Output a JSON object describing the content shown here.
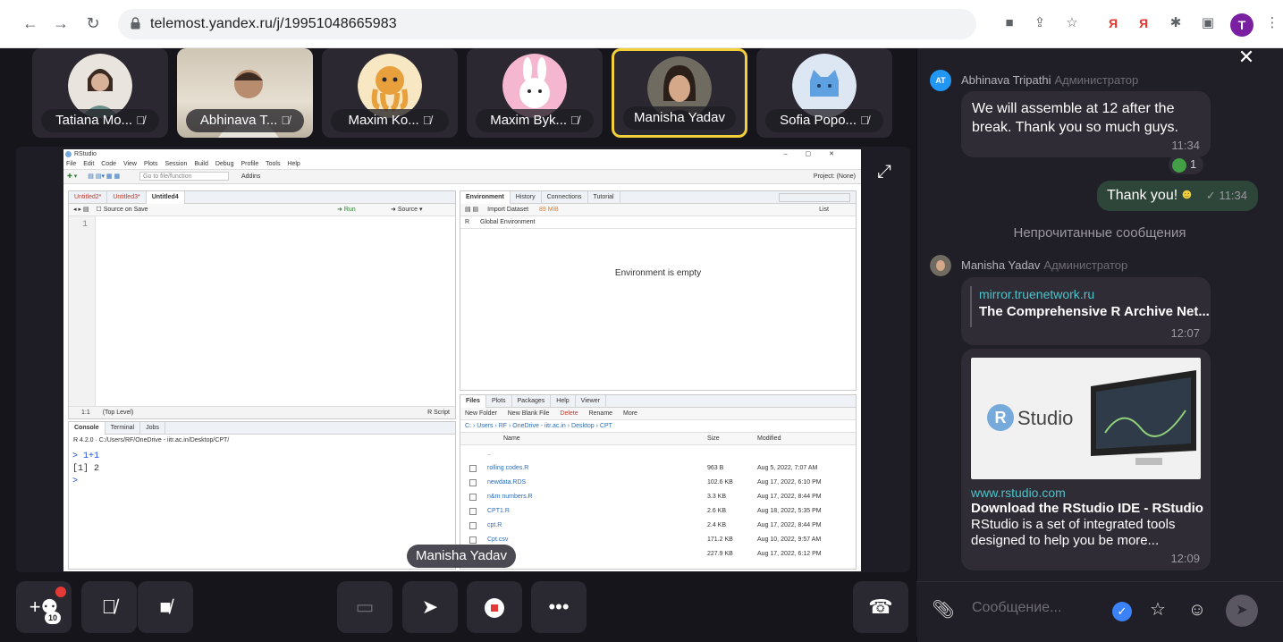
{
  "browser": {
    "url": "telemost.yandex.ru/j/19951048665983",
    "profile_initial": "T",
    "ext_ya": "Я"
  },
  "participants": [
    {
      "name": "Tatiana Mo..."
    },
    {
      "name": "Abhinava T..."
    },
    {
      "name": "Maxim Ko..."
    },
    {
      "name": "Maxim Byk..."
    },
    {
      "name": "Manisha Yadav"
    },
    {
      "name": "Sofia Popo..."
    }
  ],
  "rstudio": {
    "title": "RStudio",
    "menu": [
      "File",
      "Edit",
      "Code",
      "View",
      "Plots",
      "Session",
      "Build",
      "Debug",
      "Profile",
      "Tools",
      "Help"
    ],
    "goto_placeholder": "Go to file/function",
    "addins": "Addins",
    "project": "Project: (None)",
    "editor_tabs": [
      "Untitled2*",
      "Untitled3*",
      "Untitled4"
    ],
    "source_on_save": "Source on Save",
    "run": "Run",
    "source": "Source",
    "line_no": "1",
    "status_pos": "1:1",
    "status_level": "(Top Level)",
    "status_type": "R Script",
    "console_tabs": [
      "Console",
      "Terminal",
      "Jobs"
    ],
    "console_path": "R 4.2.0 · C:/Users/RF/OneDrive - iitr.ac.in/Desktop/CPT/",
    "console_lines": [
      "> 1+1",
      "[1] 2",
      ">"
    ],
    "env_tabs": [
      "Environment",
      "History",
      "Connections",
      "Tutorial"
    ],
    "env_toolbar": "Import Dataset",
    "env_mem": "89 MiB",
    "env_list": "List",
    "env_r": "R",
    "env_global": "Global Environment",
    "env_empty": "Environment is empty",
    "files_tabs": [
      "Files",
      "Plots",
      "Packages",
      "Help",
      "Viewer"
    ],
    "files_toolbar": [
      "New Folder",
      "New Blank File",
      "Delete",
      "Rename",
      "More"
    ],
    "files_path": "C: › Users › RF › OneDrive - iitr.ac.in › Desktop › CPT",
    "files_header": {
      "name": "Name",
      "size": "Size",
      "modified": "Modified"
    },
    "files_up": "..",
    "files": [
      {
        "name": "rolling codes.R",
        "size": "963 B",
        "modified": "Aug 5, 2022, 7:07 AM"
      },
      {
        "name": "newdata.RDS",
        "size": "102.6 KB",
        "modified": "Aug 17, 2022, 6:10 PM"
      },
      {
        "name": "n&m numbers.R",
        "size": "3.3 KB",
        "modified": "Aug 17, 2022, 8:44 PM"
      },
      {
        "name": "CPT1.R",
        "size": "2.6 KB",
        "modified": "Aug 18, 2022, 5:35 PM"
      },
      {
        "name": "cpt.R",
        "size": "2.4 KB",
        "modified": "Aug 17, 2022, 8:44 PM"
      },
      {
        "name": "Cpt.csv",
        "size": "171.2 KB",
        "modified": "Aug 10, 2022, 9:57 AM"
      },
      {
        "name": "",
        "size": "227.9 KB",
        "modified": "Aug 17, 2022, 6:12 PM"
      }
    ]
  },
  "speaker_tooltip": "Manisha Yadav",
  "controls": {
    "participants_count": "10"
  },
  "chat": {
    "messages": [
      {
        "author_initials": "AT",
        "author": "Abhinava Tripathi",
        "role": "Администратор",
        "text_line1": "We will assemble at 12 after the",
        "text_line2": "break. Thank you so much guys.",
        "time": "11:34",
        "reaction_count": "1"
      },
      {
        "mine": true,
        "text": "Thank you!",
        "emoji": "☻",
        "time": "✓ 11:34"
      }
    ],
    "unread_divider": "Непрочитанные сообщения",
    "manisha": {
      "author": "Manisha Yadav",
      "role": "Администратор",
      "link1_host": "mirror.truenetwork.ru",
      "link1_title": "The Comprehensive R Archive Net...",
      "link1_time": "12:07",
      "link2_host": "www.rstudio.com",
      "link2_title": "Download the RStudio IDE - RStudio",
      "link2_desc_line1": "RStudio is a set of integrated tools",
      "link2_desc_line2": "designed to help you be more...",
      "link2_time": "12:09",
      "preview_logo_r": "R",
      "preview_logo_text": "Studio"
    },
    "composer_placeholder": "Сообщение..."
  }
}
